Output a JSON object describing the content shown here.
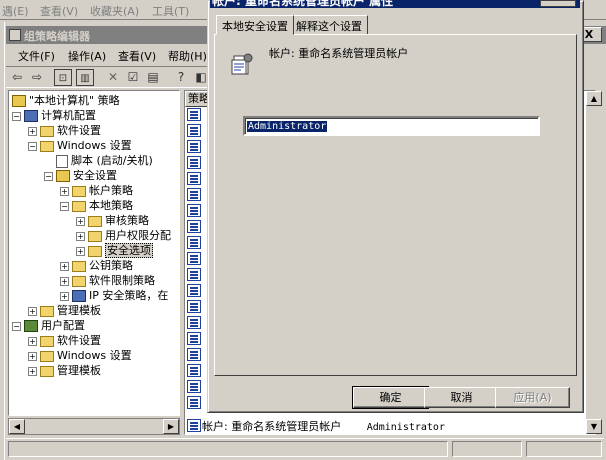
{
  "ie_menubar": {
    "items": [
      "遇(E)",
      "查看(V)",
      "收藏夹(A)",
      "工具(T)"
    ]
  },
  "mmc": {
    "title": "组策略编辑器",
    "menus": [
      "文件(F)",
      "操作(A)",
      "查看(V)",
      "帮助(H)"
    ],
    "close_label": "X"
  },
  "tree": {
    "items": [
      {
        "label": "\"本地计算机\" 策略",
        "icon": "policy-icon"
      },
      {
        "label": "计算机配置",
        "icon": "computer-icon"
      },
      {
        "label": "软件设置",
        "icon": "folder-icon"
      },
      {
        "label": "Windows 设置",
        "icon": "folder-icon"
      },
      {
        "label": "脚本 (启动/关机)",
        "icon": "script-icon"
      },
      {
        "label": "安全设置",
        "icon": "shield-icon"
      },
      {
        "label": "帐户策略",
        "icon": "folder-icon"
      },
      {
        "label": "本地策略",
        "icon": "folder-icon"
      },
      {
        "label": "审核策略",
        "icon": "folder-icon"
      },
      {
        "label": "用户权限分配",
        "icon": "folder-icon"
      },
      {
        "label": "安全选项",
        "icon": "folder-icon"
      },
      {
        "label": "公钥策略",
        "icon": "folder-icon"
      },
      {
        "label": "软件限制策略",
        "icon": "folder-icon"
      },
      {
        "label": "IP 安全策略，在",
        "icon": "ip-security-icon"
      },
      {
        "label": "管理模板",
        "icon": "folder-icon"
      },
      {
        "label": "用户配置",
        "icon": "user-icon"
      },
      {
        "label": "软件设置",
        "icon": "folder-icon"
      },
      {
        "label": "Windows 设置",
        "icon": "folder-icon"
      },
      {
        "label": "管理模板",
        "icon": "folder-icon"
      }
    ]
  },
  "list": {
    "header": "策略",
    "last_row_policy": "帐户: 重命名系统管理员帐户",
    "last_row_value": "Administrator"
  },
  "dialog": {
    "title": "帐户: 重命名系统管理员帐户 属性",
    "tabs": [
      "本地安全设置",
      "解释这个设置"
    ],
    "account_label": "帐户: 重命名系统管理员帐户",
    "input_value": "Administrator",
    "ok": "确定",
    "cancel": "取消",
    "apply": "应用(A)"
  }
}
